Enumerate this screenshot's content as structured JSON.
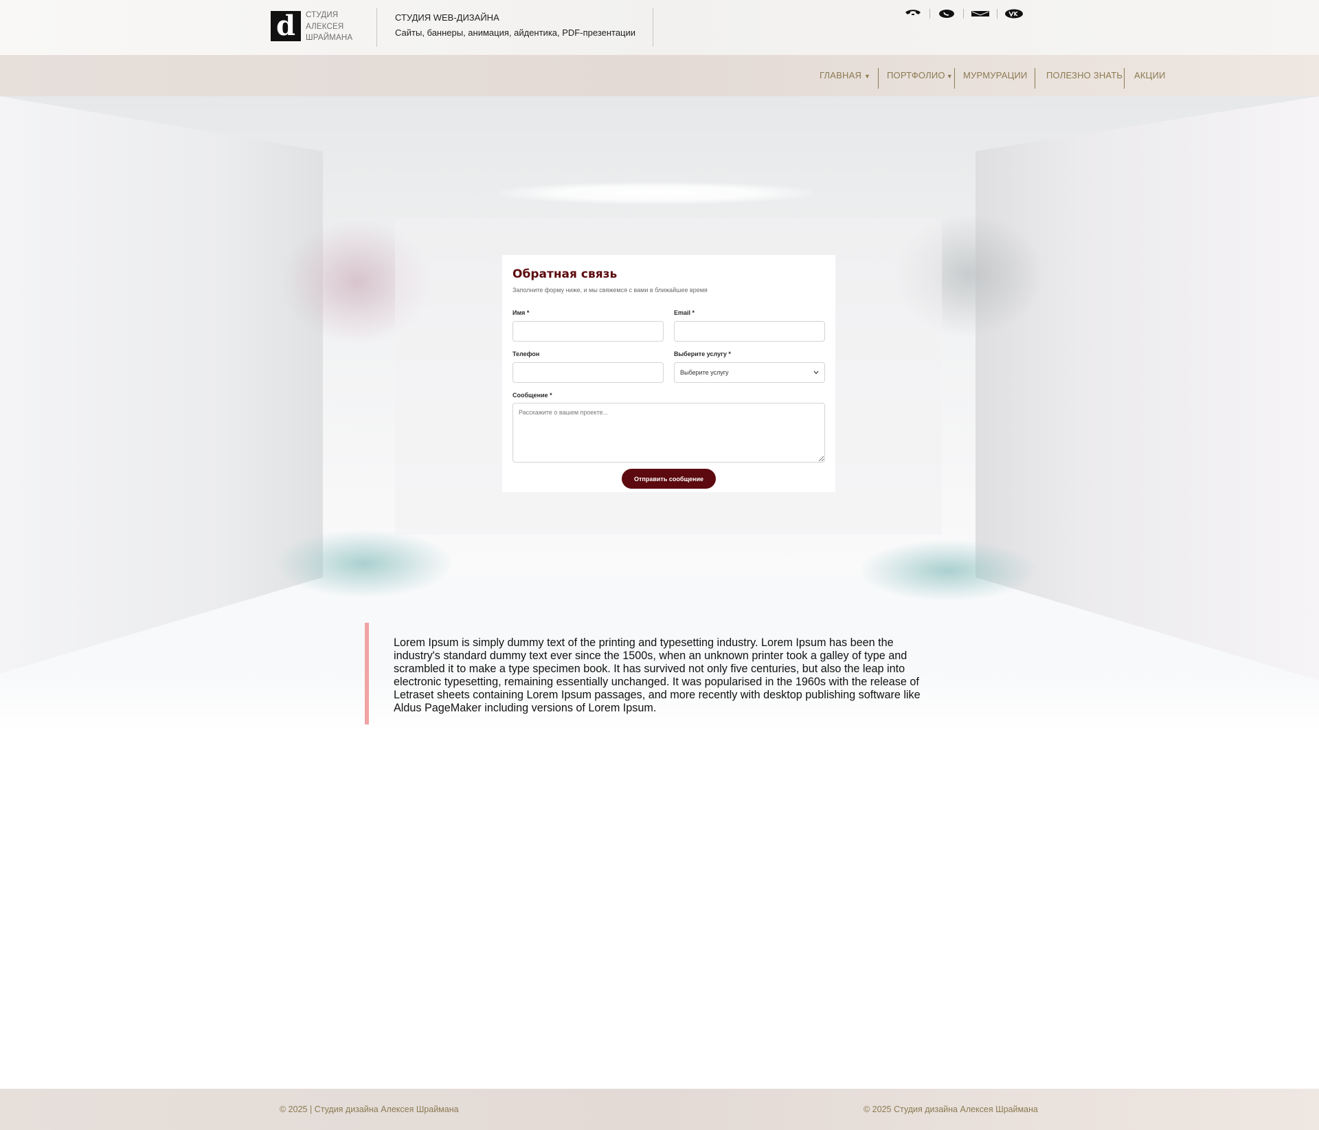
{
  "header": {
    "logo_letter": "d",
    "logo_lines": [
      "СТУДИЯ",
      "АЛЕКСЕЯ",
      "ШРАЙМАНА"
    ],
    "tagline_title": "СТУДИЯ WEB-ДИЗАЙНА",
    "tagline_subtitle": "Сайты, баннеры, анимация, айдентика, PDF-презентации",
    "contact_icons": [
      "phone-icon",
      "whatsapp-icon",
      "mail-icon",
      "vk-icon"
    ]
  },
  "nav": {
    "items": [
      {
        "label": "ГЛАВНАЯ",
        "has_dropdown": true
      },
      {
        "label": "ПОРТФОЛИО",
        "has_dropdown": true
      },
      {
        "label": "МУРМУРАЦИИ",
        "has_dropdown": false
      },
      {
        "label": "ПОЛЕЗНО ЗНАТЬ",
        "has_dropdown": false
      },
      {
        "label": "АКЦИИ",
        "has_dropdown": false
      }
    ],
    "caret": "▼",
    "color": "#8b7a52"
  },
  "form": {
    "title": "Обратная связь",
    "subtitle": "Заполните форму ниже, и мы свяжемся с вами в ближайшее время",
    "name_label": "Имя *",
    "name_value": "",
    "email_label": "Email *",
    "email_value": "",
    "phone_label": "Телефон",
    "phone_value": "",
    "service_label": "Выберите услугу *",
    "service_selected": "Выберите услугу",
    "message_label": "Сообщение *",
    "message_placeholder": "Расскажите о вашем проекте...",
    "submit_label": "Отправить сообщение",
    "accent_color": "#5c0a0f"
  },
  "quote": {
    "text": "Lorem Ipsum is simply dummy text of the printing and typesetting industry. Lorem Ipsum has been the industry's standard dummy text ever since the 1500s, when an unknown printer took a galley of type and scrambled it to make a type specimen book. It has survived not only five centuries, but also the leap into electronic typesetting, remaining essentially unchanged. It was popularised in the 1960s with the release of Letraset sheets containing Lorem Ipsum passages, and more recently with desktop publishing software like Aldus PageMaker including versions of Lorem Ipsum.",
    "bar_color": "#f1a3a3"
  },
  "footer": {
    "left": "© 2025 | Студия дизайна Алексея Шраймана",
    "right": "© 2025 Студия дизайна Алексея Шраймана"
  }
}
